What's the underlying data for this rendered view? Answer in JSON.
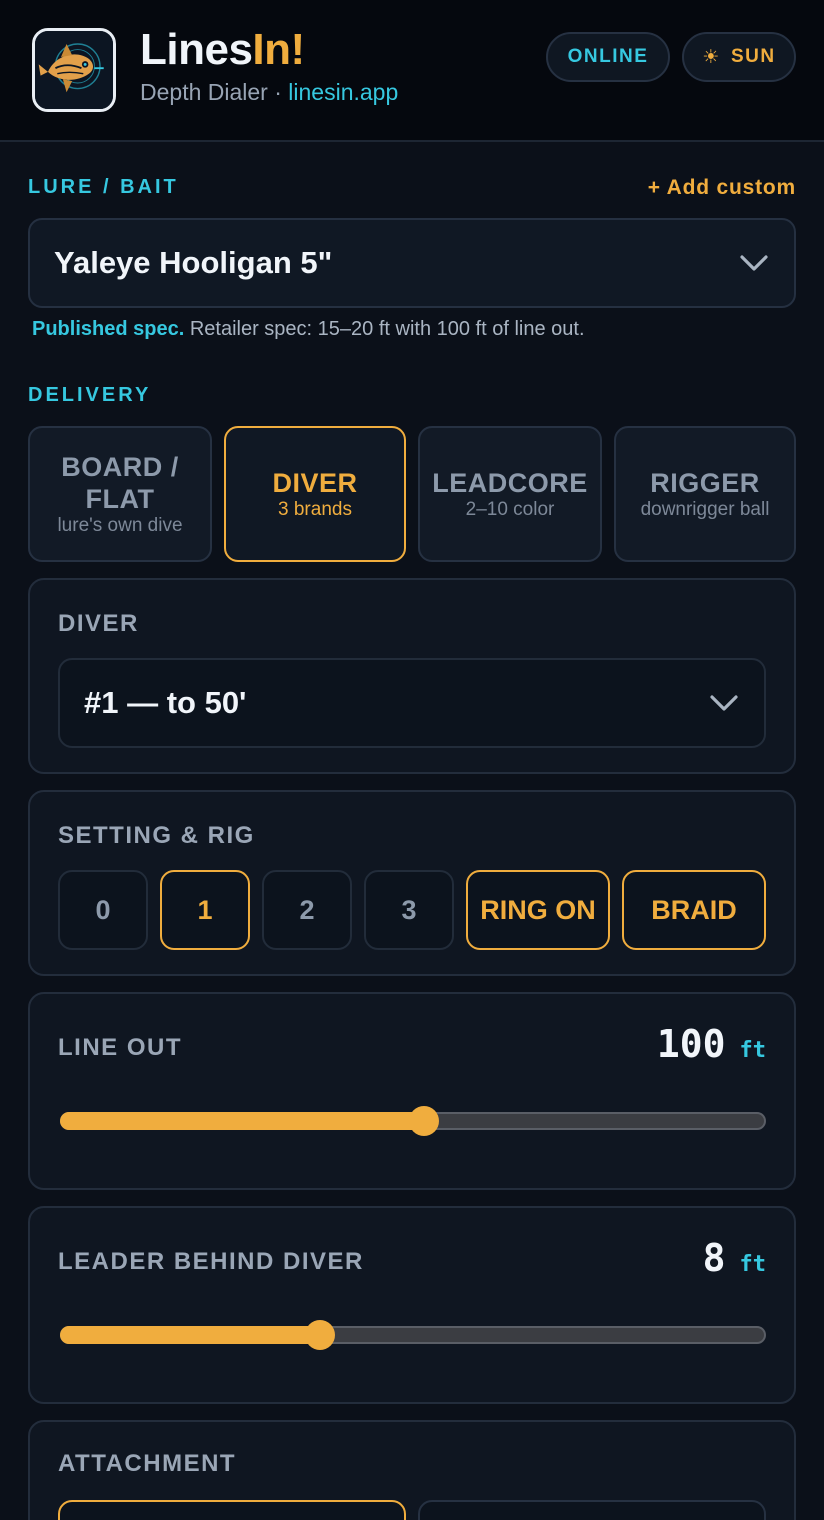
{
  "app": {
    "title_part1": "Lines",
    "title_part2": "In!",
    "subtitle": "Depth Dialer",
    "separator": " · ",
    "site": "linesin.app",
    "status": "ONLINE",
    "theme_icon": "☀",
    "theme_label": "SUN"
  },
  "lure": {
    "section_label": "LURE / BAIT",
    "add_custom": "+ Add custom",
    "selected": "Yaleye Hooligan 5\"",
    "note_strong": "Published spec.",
    "note_text": " Retailer spec: 15–20 ft with 100 ft of line out."
  },
  "delivery": {
    "section_label": "DELIVERY",
    "options": [
      {
        "label": "BOARD /\nFLAT",
        "sub": "lure's own dive",
        "active": false
      },
      {
        "label": "DIVER",
        "sub": "3 brands",
        "active": true
      },
      {
        "label": "LEADCORE",
        "sub": "2–10 color",
        "active": false
      },
      {
        "label": "RIGGER",
        "sub": "downrigger ball",
        "active": false
      }
    ]
  },
  "diver": {
    "title": "DIVER",
    "selected": "#1 — to 50'"
  },
  "setting": {
    "title": "SETTING & RIG",
    "settings": [
      "0",
      "1",
      "2",
      "3"
    ],
    "selected_setting": "1",
    "ring": "RING ON",
    "line_type": "BRAID"
  },
  "line_out": {
    "title": "LINE OUT",
    "value": "100",
    "unit": "ft",
    "fraction": 0.515
  },
  "leader": {
    "title": "LEADER BEHIND DIVER",
    "value": "8",
    "unit": "ft",
    "fraction": 0.368
  },
  "attachment": {
    "title": "ATTACHMENT"
  },
  "colors": {
    "accent": "#f0ad3e",
    "cyan": "#36c8e0",
    "background": "#0b1019"
  }
}
